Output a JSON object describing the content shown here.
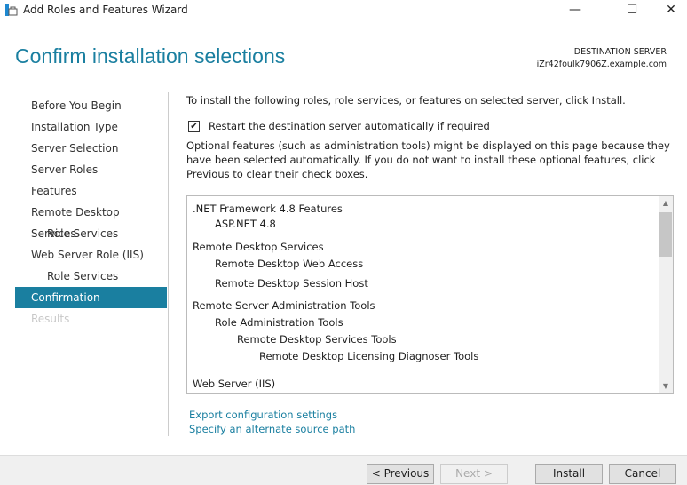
{
  "window": {
    "title": "Add Roles and Features Wizard",
    "minimize": "—",
    "maximize": "☐",
    "close": "✕"
  },
  "header": {
    "title": "Confirm installation selections",
    "dest_label": "DESTINATION SERVER",
    "dest_server": "iZr42foulk7906Z.example.com"
  },
  "nav": [
    {
      "label": "Before You Begin",
      "state": "normal"
    },
    {
      "label": "Installation Type",
      "state": "normal"
    },
    {
      "label": "Server Selection",
      "state": "normal"
    },
    {
      "label": "Server Roles",
      "state": "normal"
    },
    {
      "label": "Features",
      "state": "normal"
    },
    {
      "label": "Remote Desktop Services",
      "state": "normal"
    },
    {
      "label": "Role Services",
      "state": "sub"
    },
    {
      "label": "Web Server Role (IIS)",
      "state": "normal"
    },
    {
      "label": "Role Services",
      "state": "sub"
    },
    {
      "label": "Confirmation",
      "state": "active"
    },
    {
      "label": "Results",
      "state": "disabled"
    }
  ],
  "main": {
    "intro": "To install the following roles, role services, or features on selected server, click Install.",
    "restart_label": "Restart the destination server automatically if required",
    "restart_checked": true,
    "optional_note": "Optional features (such as administration tools) might be displayed on this page because they have been selected automatically. If you do not want to install these optional features, click Previous to clear their check boxes.",
    "items": [
      {
        "label": ".NET Framework 4.8 Features",
        "level": 0
      },
      {
        "label": "ASP.NET 4.8",
        "level": 1
      },
      {
        "label": "Remote Desktop Services",
        "level": 0
      },
      {
        "label": "Remote Desktop Web Access",
        "level": 1
      },
      {
        "label": "Remote Desktop Session Host",
        "level": 1
      },
      {
        "label": "Remote Server Administration Tools",
        "level": 0
      },
      {
        "label": "Role Administration Tools",
        "level": 1
      },
      {
        "label": "Remote Desktop Services Tools",
        "level": 2
      },
      {
        "label": "Remote Desktop Licensing Diagnoser Tools",
        "level": 3
      },
      {
        "label": "Web Server (IIS)",
        "level": 0
      }
    ],
    "export_link": "Export configuration settings",
    "source_link": "Specify an alternate source path"
  },
  "buttons": {
    "previous": "< Previous",
    "next": "Next >",
    "install": "Install",
    "cancel": "Cancel"
  }
}
